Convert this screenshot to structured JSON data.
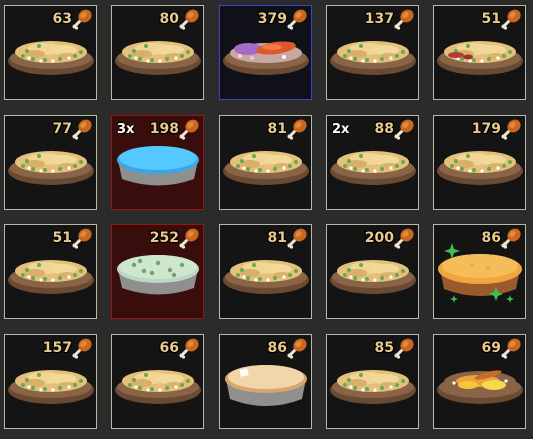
{
  "inventory": {
    "slots": [
      {
        "count": "63",
        "multiplier": "",
        "food": "scrambled-eggs",
        "style": "normal"
      },
      {
        "count": "80",
        "multiplier": "",
        "food": "scrambled-eggs",
        "style": "normal"
      },
      {
        "count": "379",
        "multiplier": "",
        "food": "salmon-platter",
        "style": "selected-blue"
      },
      {
        "count": "137",
        "multiplier": "",
        "food": "scrambled-eggs",
        "style": "normal"
      },
      {
        "count": "51",
        "multiplier": "",
        "food": "eggs-with-meat",
        "style": "normal"
      },
      {
        "count": "77",
        "multiplier": "",
        "food": "scrambled-eggs",
        "style": "normal"
      },
      {
        "count": "198",
        "multiplier": "3x",
        "food": "blue-pie",
        "style": "selected-red"
      },
      {
        "count": "81",
        "multiplier": "",
        "food": "scrambled-eggs",
        "style": "normal"
      },
      {
        "count": "88",
        "multiplier": "2x",
        "food": "scrambled-eggs",
        "style": "normal"
      },
      {
        "count": "179",
        "multiplier": "",
        "food": "scrambled-eggs",
        "style": "normal"
      },
      {
        "count": "51",
        "multiplier": "",
        "food": "scrambled-eggs",
        "style": "normal"
      },
      {
        "count": "252",
        "multiplier": "",
        "food": "mint-pie",
        "style": "selected-red"
      },
      {
        "count": "81",
        "multiplier": "",
        "food": "scrambled-eggs",
        "style": "normal"
      },
      {
        "count": "200",
        "multiplier": "",
        "food": "scrambled-eggs",
        "style": "normal"
      },
      {
        "count": "86",
        "multiplier": "",
        "food": "sparkling-pie",
        "style": "normal"
      },
      {
        "count": "157",
        "multiplier": "",
        "food": "scrambled-eggs",
        "style": "normal"
      },
      {
        "count": "66",
        "multiplier": "",
        "food": "scrambled-eggs",
        "style": "normal"
      },
      {
        "count": "86",
        "multiplier": "",
        "food": "cream-pie",
        "style": "normal"
      },
      {
        "count": "85",
        "multiplier": "",
        "food": "scrambled-eggs",
        "style": "normal"
      },
      {
        "count": "69",
        "multiplier": "",
        "food": "fish-omelette",
        "style": "normal"
      }
    ]
  },
  "icons": {
    "count_icon": "drumstick-icon"
  },
  "colors": {
    "background": "#2b2b2b",
    "slot_border": "#b9b9a6",
    "selected_blue": "#3c44c8",
    "selected_red": "#9b1414",
    "count_text": "#e9c98d"
  }
}
